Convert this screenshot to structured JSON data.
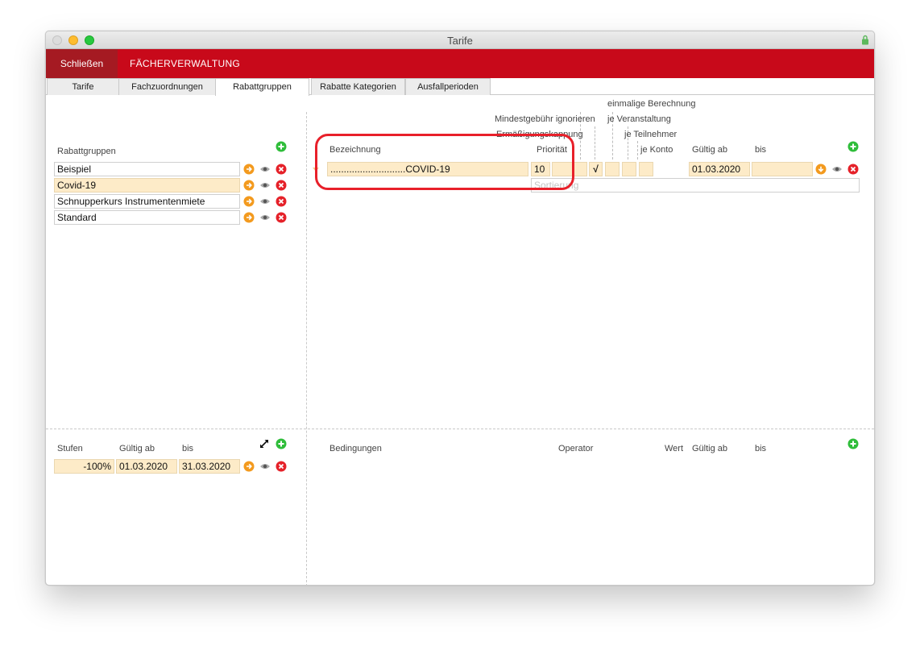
{
  "window": {
    "title": "Tarife"
  },
  "toolbar": {
    "close_label": "Schließen",
    "section_label": "FÄCHERVERWALTUNG"
  },
  "tabs": [
    {
      "label": "Tarife"
    },
    {
      "label": "Fachzuordnungen"
    },
    {
      "label": "Rabattgruppen"
    },
    {
      "label": "Rabatte Kategorien"
    },
    {
      "label": "Ausfallperioden"
    }
  ],
  "left": {
    "header": "Rabattgruppen",
    "groups": [
      {
        "name": "Beispiel"
      },
      {
        "name": "Covid-19"
      },
      {
        "name": "Schnupperkurs Instrumentenmiete"
      },
      {
        "name": "Standard"
      }
    ]
  },
  "right": {
    "headers": {
      "einmalige": "einmalige Berechnung",
      "mindest": "Mindestgebühr ignorieren",
      "veranstaltung": "je Veranstaltung",
      "ermaessigung": "Ermäßigungskappung",
      "teilnehmer": "je Teilnehmer",
      "bezeichnung": "Bezeichnung",
      "prioritaet": "Priorität",
      "konto": "je Konto",
      "gueltig_ab": "Gültig ab",
      "bis": "bis"
    },
    "rabatt": {
      "bezeichnung": "............................COVID-19",
      "prioritaet": "10",
      "check": "√",
      "gueltig_ab": "01.03.2020",
      "bis": "",
      "sortierung_placeholder": "Sortierung"
    }
  },
  "stufen": {
    "headers": {
      "stufen": "Stufen",
      "gueltig_ab": "Gültig ab",
      "bis": "bis"
    },
    "rows": [
      {
        "value": "-100%",
        "gueltig_ab": "01.03.2020",
        "bis": "31.03.2020"
      }
    ]
  },
  "bedingungen": {
    "headers": {
      "bedingungen": "Bedingungen",
      "operator": "Operator",
      "wert": "Wert",
      "gueltig_ab": "Gültig ab",
      "bis": "bis"
    }
  },
  "colors": {
    "accent": "#c8091a",
    "highlight": "#fdebc8",
    "add": "#2fbd3a",
    "delete": "#e52129",
    "arrow": "#f39a1e"
  }
}
